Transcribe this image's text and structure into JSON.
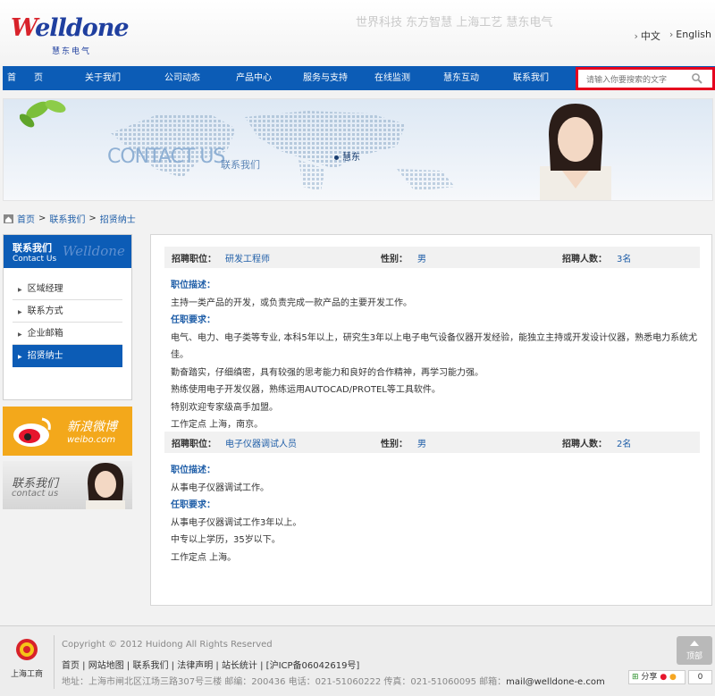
{
  "header": {
    "logo_text_prefix": "W",
    "logo_text_rest": "elldone",
    "logo_sub": "慧东电气",
    "slogan": "世界科技 东方智慧 上海工艺 慧东电气",
    "lang_cn": "中文",
    "lang_en": "English"
  },
  "nav": {
    "items": [
      "首　　页",
      "关于我们",
      "公司动态",
      "产品中心",
      "服务与支持",
      "在线监测",
      "慧东互动",
      "联系我们"
    ],
    "search_placeholder": "请输入你要搜索的文字"
  },
  "banner": {
    "title_en": "CONTACT US",
    "title_cn": "联系我们",
    "location": "慧东"
  },
  "breadcrumb": [
    "首页",
    "联系我们",
    "招贤纳士"
  ],
  "sidebar": {
    "title_cn": "联系我们",
    "title_en": "Contact Us",
    "watermark": "Welldone",
    "items": [
      "区域经理",
      "联系方式",
      "企业邮箱",
      "招贤纳士"
    ],
    "active_index": 3
  },
  "weibo": {
    "cn": "新浪微博",
    "en": "weibo.com"
  },
  "contact_box": {
    "cn": "联系我们",
    "en": "contact us"
  },
  "jobs": [
    {
      "position_label": "招聘职位：",
      "position": "研发工程师",
      "gender_label": "性别：",
      "gender": "男",
      "count_label": "招聘人数：",
      "count": "3名",
      "desc_label": "职位描述：",
      "desc": [
        "主持一类产品的开发，或负责完成一款产品的主要开发工作。"
      ],
      "req_label": "任职要求：",
      "req": [
        "电气、电力、电子类等专业, 本科5年以上，研究生3年以上电子电气设备仪器开发经验，能独立主持或开发设计仪器，熟悉电力系统尤佳。",
        "勤奋踏实，仔细缜密，具有较强的思考能力和良好的合作精神，再学习能力强。",
        "熟练使用电子开发仪器，熟练运用AUTOCAD/PROTEL等工具软件。",
        "特别欢迎专家级高手加盟。",
        "工作定点 上海，南京。"
      ]
    },
    {
      "position_label": "招聘职位：",
      "position": "电子仪器调试人员",
      "gender_label": "性别：",
      "gender": "男",
      "count_label": "招聘人数：",
      "count": "2名",
      "desc_label": "职位描述：",
      "desc": [
        "从事电子仪器调试工作。"
      ],
      "req_label": "任职要求：",
      "req": [
        "从事电子仪器调试工作3年以上。",
        "中专以上学历，35岁以下。",
        "工作定点 上海。"
      ]
    }
  ],
  "footer": {
    "gov_label": "上海工商",
    "copyright": "Copyright © 2012 Huidong All Rights Reserved",
    "links": [
      "首页",
      "网站地图",
      "联系我们",
      "法律声明",
      "站长统计",
      "[沪ICP备06042619号]"
    ],
    "address": "地址：上海市闸北区江场三路307号三楼 邮编：200436 电话：021-51060222 传真：021-51060095 邮箱：",
    "email": "mail@welldone-e.com",
    "top_label": "顶部",
    "share_label": "分享",
    "share_count": "0"
  }
}
